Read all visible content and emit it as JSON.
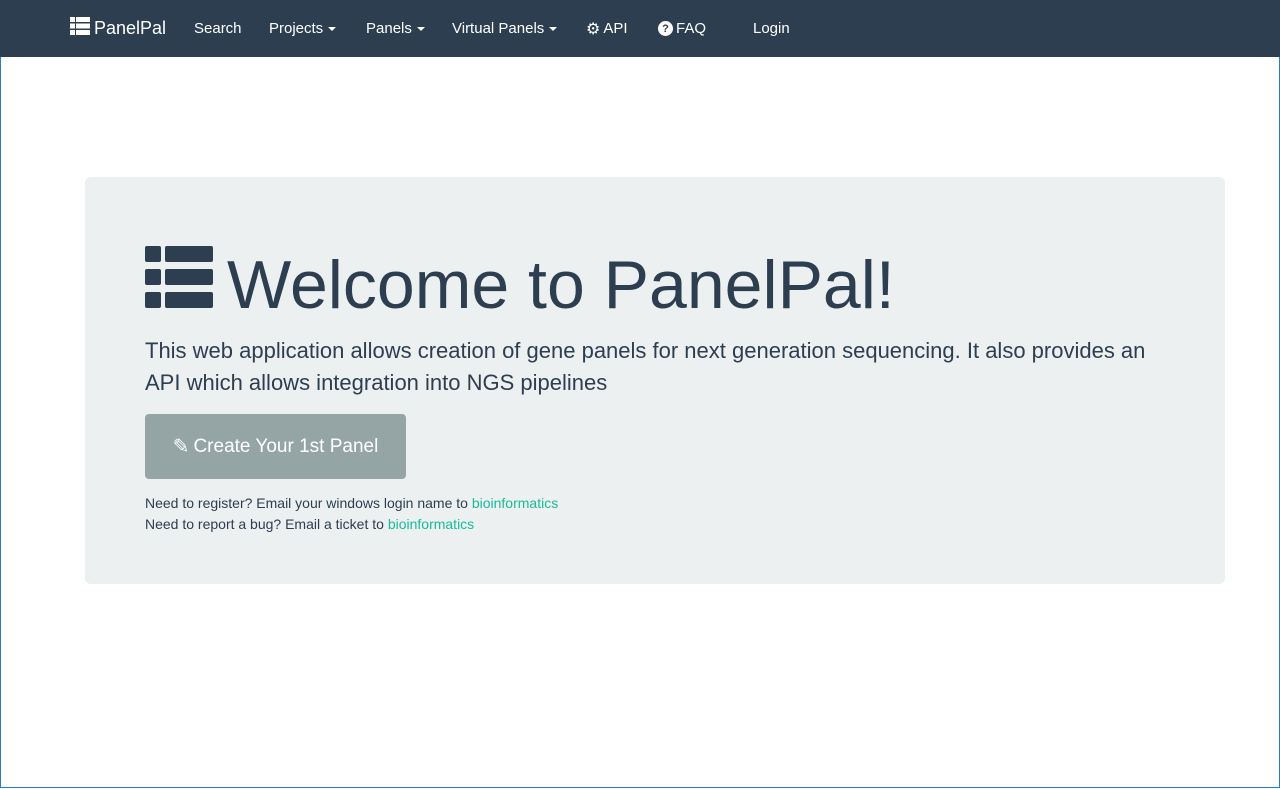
{
  "nav": {
    "brand": "PanelPal",
    "items": [
      {
        "label": "Search"
      },
      {
        "label": "Projects"
      },
      {
        "label": "Panels"
      },
      {
        "label": "Virtual Panels"
      },
      {
        "label": "API",
        "icon": "gear-icon"
      },
      {
        "label": "FAQ",
        "icon": "question-circle-icon"
      },
      {
        "label": "Login"
      }
    ]
  },
  "hero": {
    "title": "Welcome to PanelPal!",
    "lead": "This web application allows creation of gene panels for next generation sequencing. It also provides an API which allows integration into NGS pipelines",
    "cta_label": "Create Your 1st Panel",
    "register_text": "Need to register? Email your windows login name to ",
    "register_link": "bioinformatics",
    "bug_text": "Need to report a bug? Email a ticket to ",
    "bug_link": "bioinformatics"
  },
  "colors": {
    "navbar": "#2c3e50",
    "jumbotron": "#ecf0f1",
    "button": "#95a5a6",
    "link": "#18bc9c"
  }
}
